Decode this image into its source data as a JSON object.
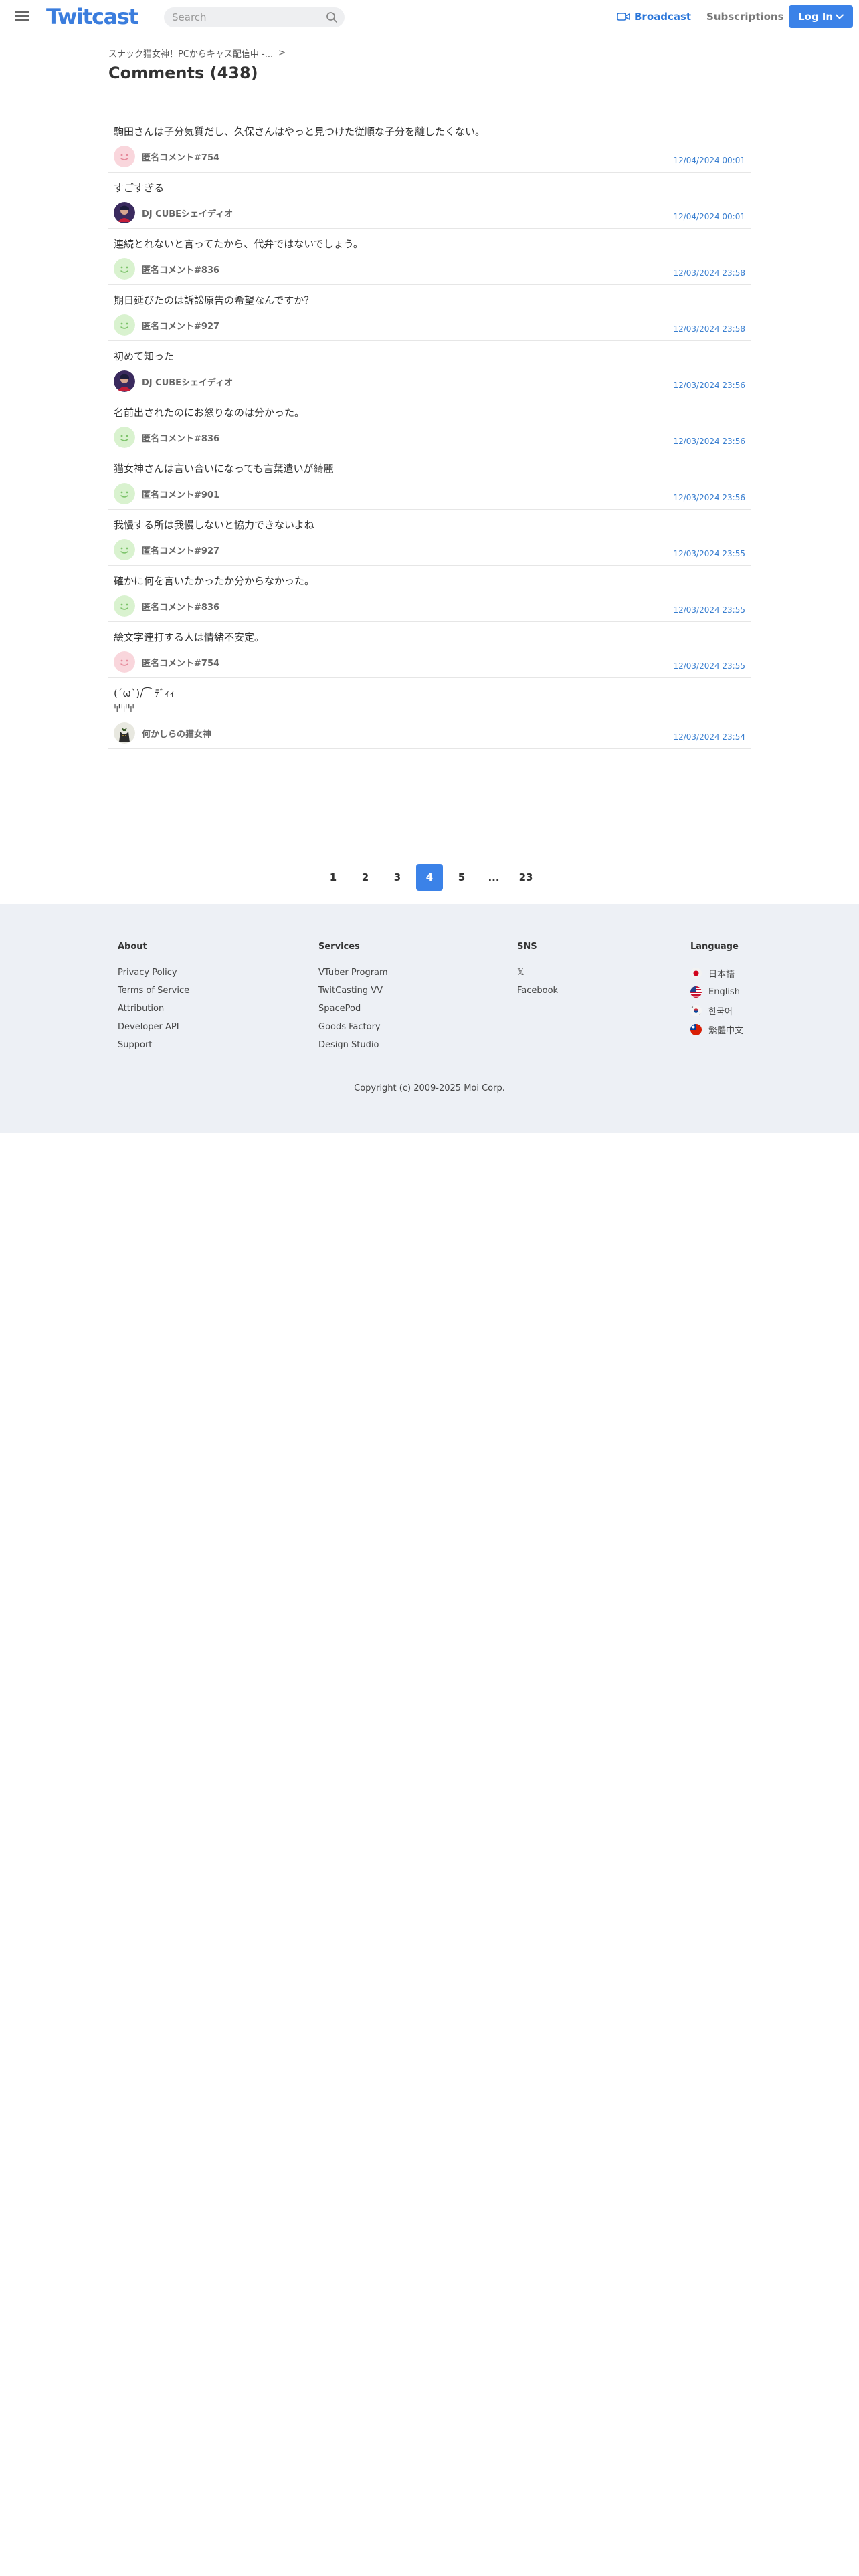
{
  "header": {
    "logo": "Twitcast",
    "search_placeholder": "Search",
    "broadcast_label": "Broadcast",
    "subscriptions_label": "Subscriptions",
    "login_label": "Log In",
    "accent_color": "#3b82e8"
  },
  "breadcrumb": {
    "label": "スナック猫女神！PCからキャス配信中 -...",
    "separator": ">"
  },
  "page_title": "Comments (438)",
  "comments": [
    {
      "text": "駒田さんは子分気質だし、久保さんはやっと見つけた従順な子分を離したくない。",
      "author": "匿名コメント#754",
      "avatar": "anonymous-pink",
      "date": "12/04/2024 00:01"
    },
    {
      "text": "すごすぎる",
      "author": "DJ CUBEシェイディオ",
      "avatar": "dj-photo",
      "date": "12/04/2024 00:01"
    },
    {
      "text": "連続とれないと言ってたから、代弁ではないでしょう。",
      "author": "匿名コメント#836",
      "avatar": "anonymous-green",
      "date": "12/03/2024 23:58"
    },
    {
      "text": "期日延びたのは訴訟原告の希望なんですか？",
      "author": "匿名コメント#927",
      "avatar": "anonymous-green",
      "date": "12/03/2024 23:58"
    },
    {
      "text": "初めて知った",
      "author": "DJ CUBEシェイディオ",
      "avatar": "dj-photo",
      "date": "12/03/2024 23:56"
    },
    {
      "text": "名前出されたのにお怒りなのは分かった。",
      "author": "匿名コメント#836",
      "avatar": "anonymous-green",
      "date": "12/03/2024 23:56"
    },
    {
      "text": "猫女神さんは言い合いになっても言葉遣いが綺麗",
      "author": "匿名コメント#901",
      "avatar": "anonymous-green",
      "date": "12/03/2024 23:56"
    },
    {
      "text": "我慢する所は我慢しないと協力できないよね",
      "author": "匿名コメント#927",
      "avatar": "anonymous-green",
      "date": "12/03/2024 23:55"
    },
    {
      "text": "確かに何を言いたかったか分からなかった。",
      "author": "匿名コメント#836",
      "avatar": "anonymous-green",
      "date": "12/03/2024 23:55"
    },
    {
      "text": "絵文字連打する人は情緒不安定。",
      "author": "匿名コメント#754",
      "avatar": "anonymous-pink",
      "date": "12/03/2024 23:55"
    },
    {
      "text": "(´ω`)/⁀  ﾃﾞｨｨ\n𐀀𐀀𐀀",
      "author": "何かしらの猫女神",
      "avatar": "cat-photo",
      "date": "12/03/2024 23:54"
    }
  ],
  "pagination": {
    "pages": [
      "1",
      "2",
      "3",
      "4",
      "5",
      "...",
      "23"
    ],
    "current": "4"
  },
  "footer": {
    "about": {
      "heading": "About",
      "links": [
        "Privacy Policy",
        "Terms of Service",
        "Attribution",
        "Developer API",
        "Support"
      ]
    },
    "services": {
      "heading": "Services",
      "links": [
        "VTuber Program",
        "TwitCasting VV",
        "SpacePod",
        "Goods Factory",
        "Design Studio"
      ]
    },
    "sns": {
      "heading": "SNS",
      "links": [
        "𝕏",
        "Facebook"
      ]
    },
    "language": {
      "heading": "Language",
      "items": [
        {
          "label": "日本語",
          "flag": "japan-flag"
        },
        {
          "label": "English",
          "flag": "us-flag"
        },
        {
          "label": "한국어",
          "flag": "korea-flag"
        },
        {
          "label": "繁體中文",
          "flag": "taiwan-flag"
        }
      ]
    },
    "copyright": "Copyright (c) 2009-2025 Moi Corp."
  }
}
